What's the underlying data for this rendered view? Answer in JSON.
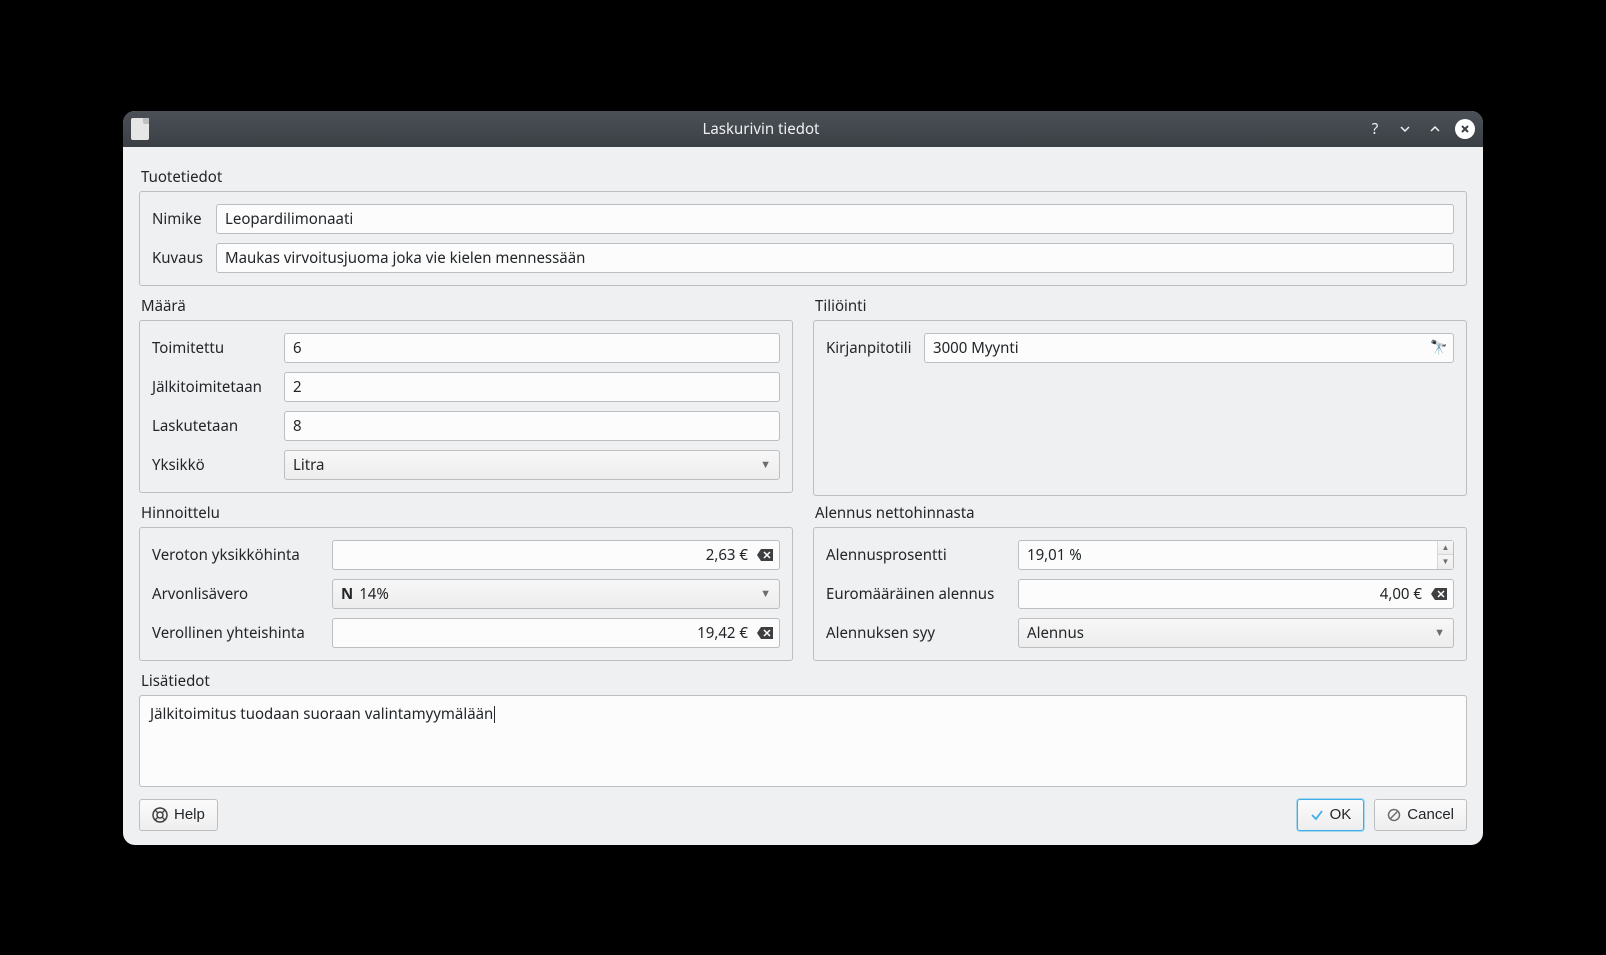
{
  "window": {
    "title": "Laskurivin tiedot"
  },
  "product": {
    "section_label": "Tuotetiedot",
    "name_label": "Nimike",
    "name_value": "Leopardilimonaati",
    "desc_label": "Kuvaus",
    "desc_value": "Maukas virvoitusjuoma joka vie kielen mennessään"
  },
  "quantity": {
    "section_label": "Määrä",
    "delivered_label": "Toimitettu",
    "delivered_value": "6",
    "backordered_label": "Jälkitoimitetaan",
    "backordered_value": "2",
    "invoiced_label": "Laskutetaan",
    "invoiced_value": "8",
    "unit_label": "Yksikkö",
    "unit_value": "Litra"
  },
  "posting": {
    "section_label": "Tiliöinti",
    "account_label": "Kirjanpitotili",
    "account_value": "3000 Myynti"
  },
  "pricing": {
    "section_label": "Hinnoittelu",
    "unit_price_label": "Veroton yksikköhinta",
    "unit_price_value": "2,63 €",
    "vat_label": "Arvonlisävero",
    "vat_letter": "N",
    "vat_value": "14%",
    "total_label": "Verollinen yhteishinta",
    "total_value": "19,42 €"
  },
  "discount": {
    "section_label": "Alennus nettohinnasta",
    "percent_label": "Alennusprosentti",
    "percent_value": "19,01 %",
    "amount_label": "Euromääräinen alennus",
    "amount_value": "4,00 €",
    "reason_label": "Alennuksen syy",
    "reason_value": "Alennus"
  },
  "extra": {
    "section_label": "Lisätiedot",
    "value": "Jälkitoimitus tuodaan suoraan valintamyymälään"
  },
  "buttons": {
    "help": "Help",
    "ok": "OK",
    "cancel": "Cancel"
  }
}
